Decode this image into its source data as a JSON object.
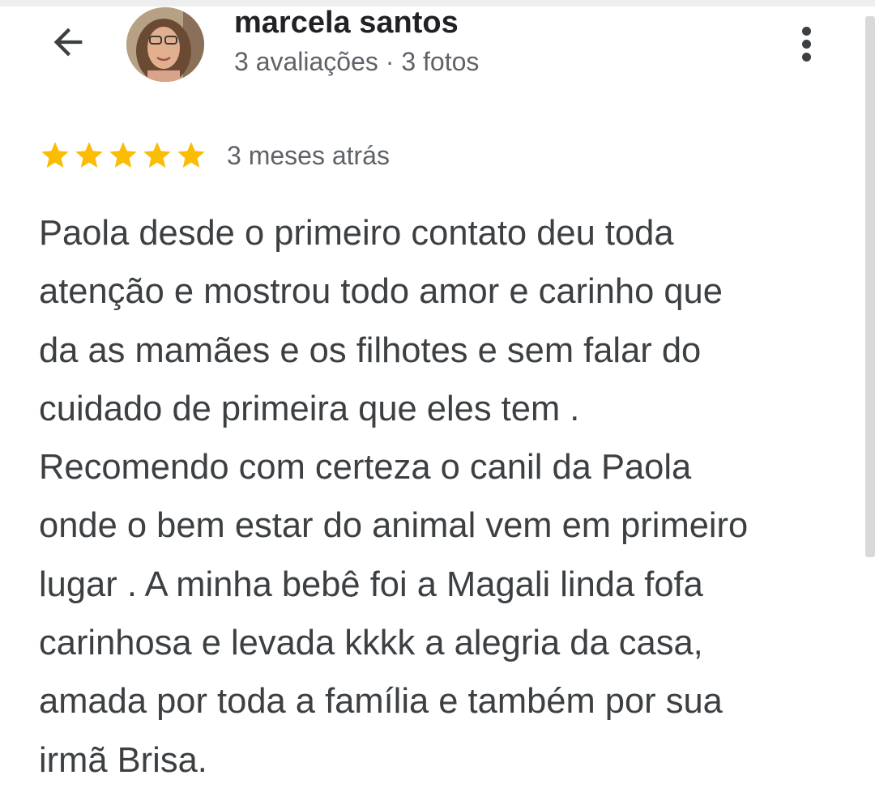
{
  "header": {
    "user_name": "marcela santos",
    "user_meta": "3 avaliações · 3 fotos",
    "back_icon": "arrow-left-icon",
    "more_icon": "more-vert-icon"
  },
  "review": {
    "rating": 5,
    "rating_max": 5,
    "star_color": "#fbbc04",
    "time": "3 meses atrás",
    "lines": [
      "Paola desde o primeiro contato deu toda",
      "atenção e mostrou todo amor e carinho que",
      "da as mamães e os filhotes e sem falar do",
      "cuidado de primeira que eles tem .",
      "Recomendo com certeza o canil da Paola",
      "onde o bem estar do animal vem em primeiro",
      "lugar . A minha bebê foi a Magali linda fofa",
      "carinhosa e levada kkkk a alegria da casa,",
      "amada por toda a família e também por sua",
      "irmã Brisa."
    ]
  },
  "colors": {
    "text": "#3c4043",
    "name": "#202124",
    "meta": "#5f6368",
    "star": "#fbbc04"
  }
}
